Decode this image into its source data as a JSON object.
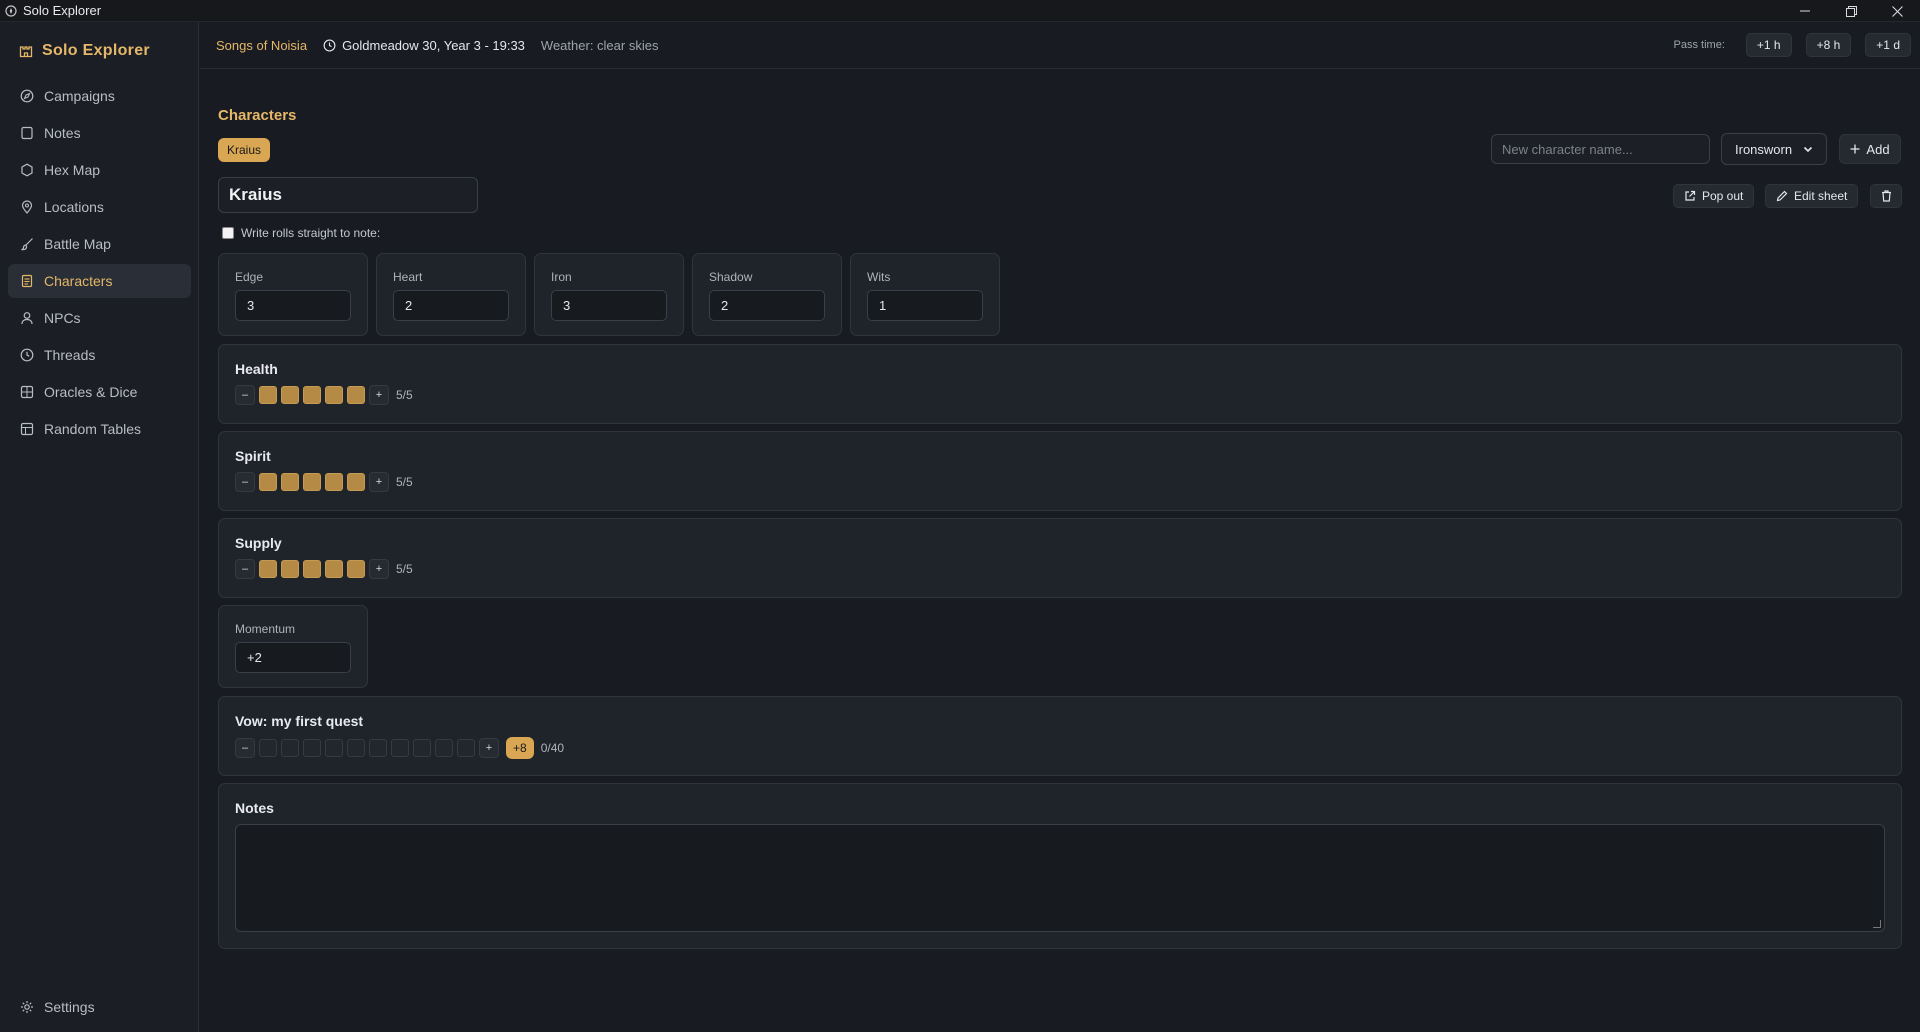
{
  "window": {
    "title": "Solo Explorer"
  },
  "sidebar": {
    "brand": "Solo Explorer",
    "items": [
      {
        "label": "Campaigns",
        "icon": "compass-icon"
      },
      {
        "label": "Notes",
        "icon": "note-icon"
      },
      {
        "label": "Hex Map",
        "icon": "hexagon-icon"
      },
      {
        "label": "Locations",
        "icon": "map-pin-icon"
      },
      {
        "label": "Battle Map",
        "icon": "brush-icon"
      },
      {
        "label": "Characters",
        "icon": "character-sheet-icon",
        "active": true
      },
      {
        "label": "NPCs",
        "icon": "person-icon"
      },
      {
        "label": "Threads",
        "icon": "clock-icon"
      },
      {
        "label": "Oracles & Dice",
        "icon": "dice-icon"
      },
      {
        "label": "Random Tables",
        "icon": "table-icon"
      }
    ],
    "settings_label": "Settings"
  },
  "topbar": {
    "campaign": "Songs of Noisia",
    "date": "Goldmeadow 30, Year 3 - 19:33",
    "weather": "Weather: clear skies",
    "pass_time_label": "Pass time:",
    "pass_buttons": [
      "+1 h",
      "+8 h",
      "+1 d"
    ]
  },
  "main": {
    "section_title": "Characters",
    "character_tab": "Kraius",
    "new_character_placeholder": "New character name...",
    "system_select": "Ironsworn",
    "add_label": "Add",
    "name_value": "Kraius",
    "pop_out_label": "Pop out",
    "edit_sheet_label": "Edit sheet",
    "write_rolls_label": "Write rolls straight to note:",
    "stats": [
      {
        "label": "Edge",
        "value": "3"
      },
      {
        "label": "Heart",
        "value": "2"
      },
      {
        "label": "Iron",
        "value": "3"
      },
      {
        "label": "Shadow",
        "value": "2"
      },
      {
        "label": "Wits",
        "value": "1"
      }
    ],
    "health": {
      "title": "Health",
      "value": "5/5",
      "filled": 5,
      "total": 5
    },
    "spirit": {
      "title": "Spirit",
      "value": "5/5",
      "filled": 5,
      "total": 5
    },
    "supply": {
      "title": "Supply",
      "value": "5/5",
      "filled": 5,
      "total": 5
    },
    "momentum": {
      "label": "Momentum",
      "value": "+2"
    },
    "vow": {
      "title": "Vow: my first quest",
      "badge": "+8",
      "value": "0/40",
      "filled": 0,
      "total": 10
    },
    "notes": {
      "title": "Notes"
    },
    "minus": "–",
    "plus": "+"
  },
  "colors": {
    "accent": "#e5b769",
    "track_fill": "#b48a45",
    "badge": "#d9a653",
    "background": "#181b21"
  }
}
